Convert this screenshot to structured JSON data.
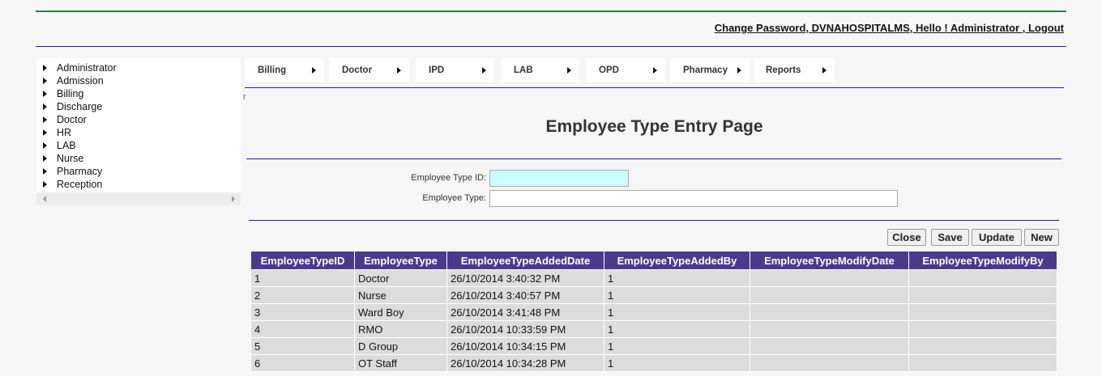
{
  "header": {
    "change_password": "Change Password",
    "sep1": ", ",
    "hospital": "DVNAHOSPITALMS",
    "sep2": ", ",
    "greeting": "Hello ! Administrator ",
    "sep3": ", ",
    "logout": "Logout"
  },
  "sidebar": {
    "items": [
      {
        "label": "Administrator"
      },
      {
        "label": "Admission"
      },
      {
        "label": "Billing"
      },
      {
        "label": "Discharge"
      },
      {
        "label": "Doctor"
      },
      {
        "label": "HR"
      },
      {
        "label": "LAB"
      },
      {
        "label": "Nurse"
      },
      {
        "label": "Pharmacy"
      },
      {
        "label": "Reception"
      }
    ]
  },
  "menu": {
    "items": [
      {
        "label": "Billing"
      },
      {
        "label": "Doctor"
      },
      {
        "label": "IPD"
      },
      {
        "label": "LAB"
      },
      {
        "label": "OPD"
      },
      {
        "label": "Pharmacy"
      },
      {
        "label": "Reports"
      }
    ]
  },
  "stray_char": "r",
  "page": {
    "title": "Employee Type Entry Page"
  },
  "form": {
    "type_id_label": "Employee Type ID:",
    "type_id_value": "",
    "type_label": "Employee Type:",
    "type_value": ""
  },
  "buttons": {
    "close": "Close",
    "save": "Save",
    "update": "Update",
    "new": "New"
  },
  "table": {
    "headers": [
      "EmployeeTypeID",
      "EmployeeType",
      "EmployeeTypeAddedDate",
      "EmployeeTypeAddedBy",
      "EmployeeTypeModifyDate",
      "EmployeeTypeModifyBy"
    ],
    "rows": [
      [
        "1",
        "Doctor",
        "26/10/2014 3:40:32 PM",
        "1",
        "",
        ""
      ],
      [
        "2",
        "Nurse",
        "26/10/2014 3:40:57 PM",
        "1",
        "",
        ""
      ],
      [
        "3",
        "Ward Boy",
        "26/10/2014 3:41:48 PM",
        "1",
        "",
        ""
      ],
      [
        "4",
        "RMO",
        "26/10/2014 10:33:59 PM",
        "1",
        "",
        ""
      ],
      [
        "5",
        "D Group",
        "26/10/2014 10:34:15 PM",
        "1",
        "",
        ""
      ],
      [
        "6",
        "OT Staff",
        "26/10/2014 10:34:28 PM",
        "1",
        "",
        ""
      ]
    ]
  },
  "colors": {
    "header_line": "#2e7d32",
    "rule": "#1a1aa0",
    "table_header": "#4b3a8c",
    "table_cell": "#dcdcdc",
    "id_input_bg": "#ccffff"
  }
}
